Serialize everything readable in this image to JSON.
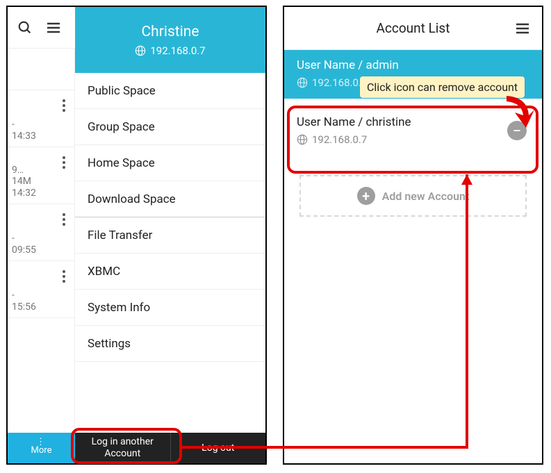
{
  "left": {
    "header_user": "Christine",
    "header_ip": "192.168.0.7",
    "rows": [
      {
        "line1": "-",
        "line2": "",
        "time": "14:33"
      },
      {
        "line1": "9…",
        "line2": "14M",
        "time": "14:32"
      },
      {
        "line1": "-",
        "line2": "",
        "time": "09:55"
      },
      {
        "line1": "-",
        "line2": "",
        "time": "15:56"
      }
    ],
    "menu": [
      "Public Space",
      "Group Space",
      "Home Space",
      "Download Space",
      "File Transfer",
      "XBMC",
      "System Info",
      "Settings"
    ],
    "footer_login_another": "Log in another Account",
    "footer_logout": "Log out",
    "more_label": "More"
  },
  "right": {
    "title": "Account List",
    "accounts": [
      {
        "name": "User Name / admin",
        "ip": "192.168.0.7",
        "active": true
      },
      {
        "name": "User Name / christine",
        "ip": "192.168.0.7",
        "active": false
      }
    ],
    "add_label": "Add new Account"
  },
  "annotation": {
    "tooltip": "Click icon can remove account"
  }
}
